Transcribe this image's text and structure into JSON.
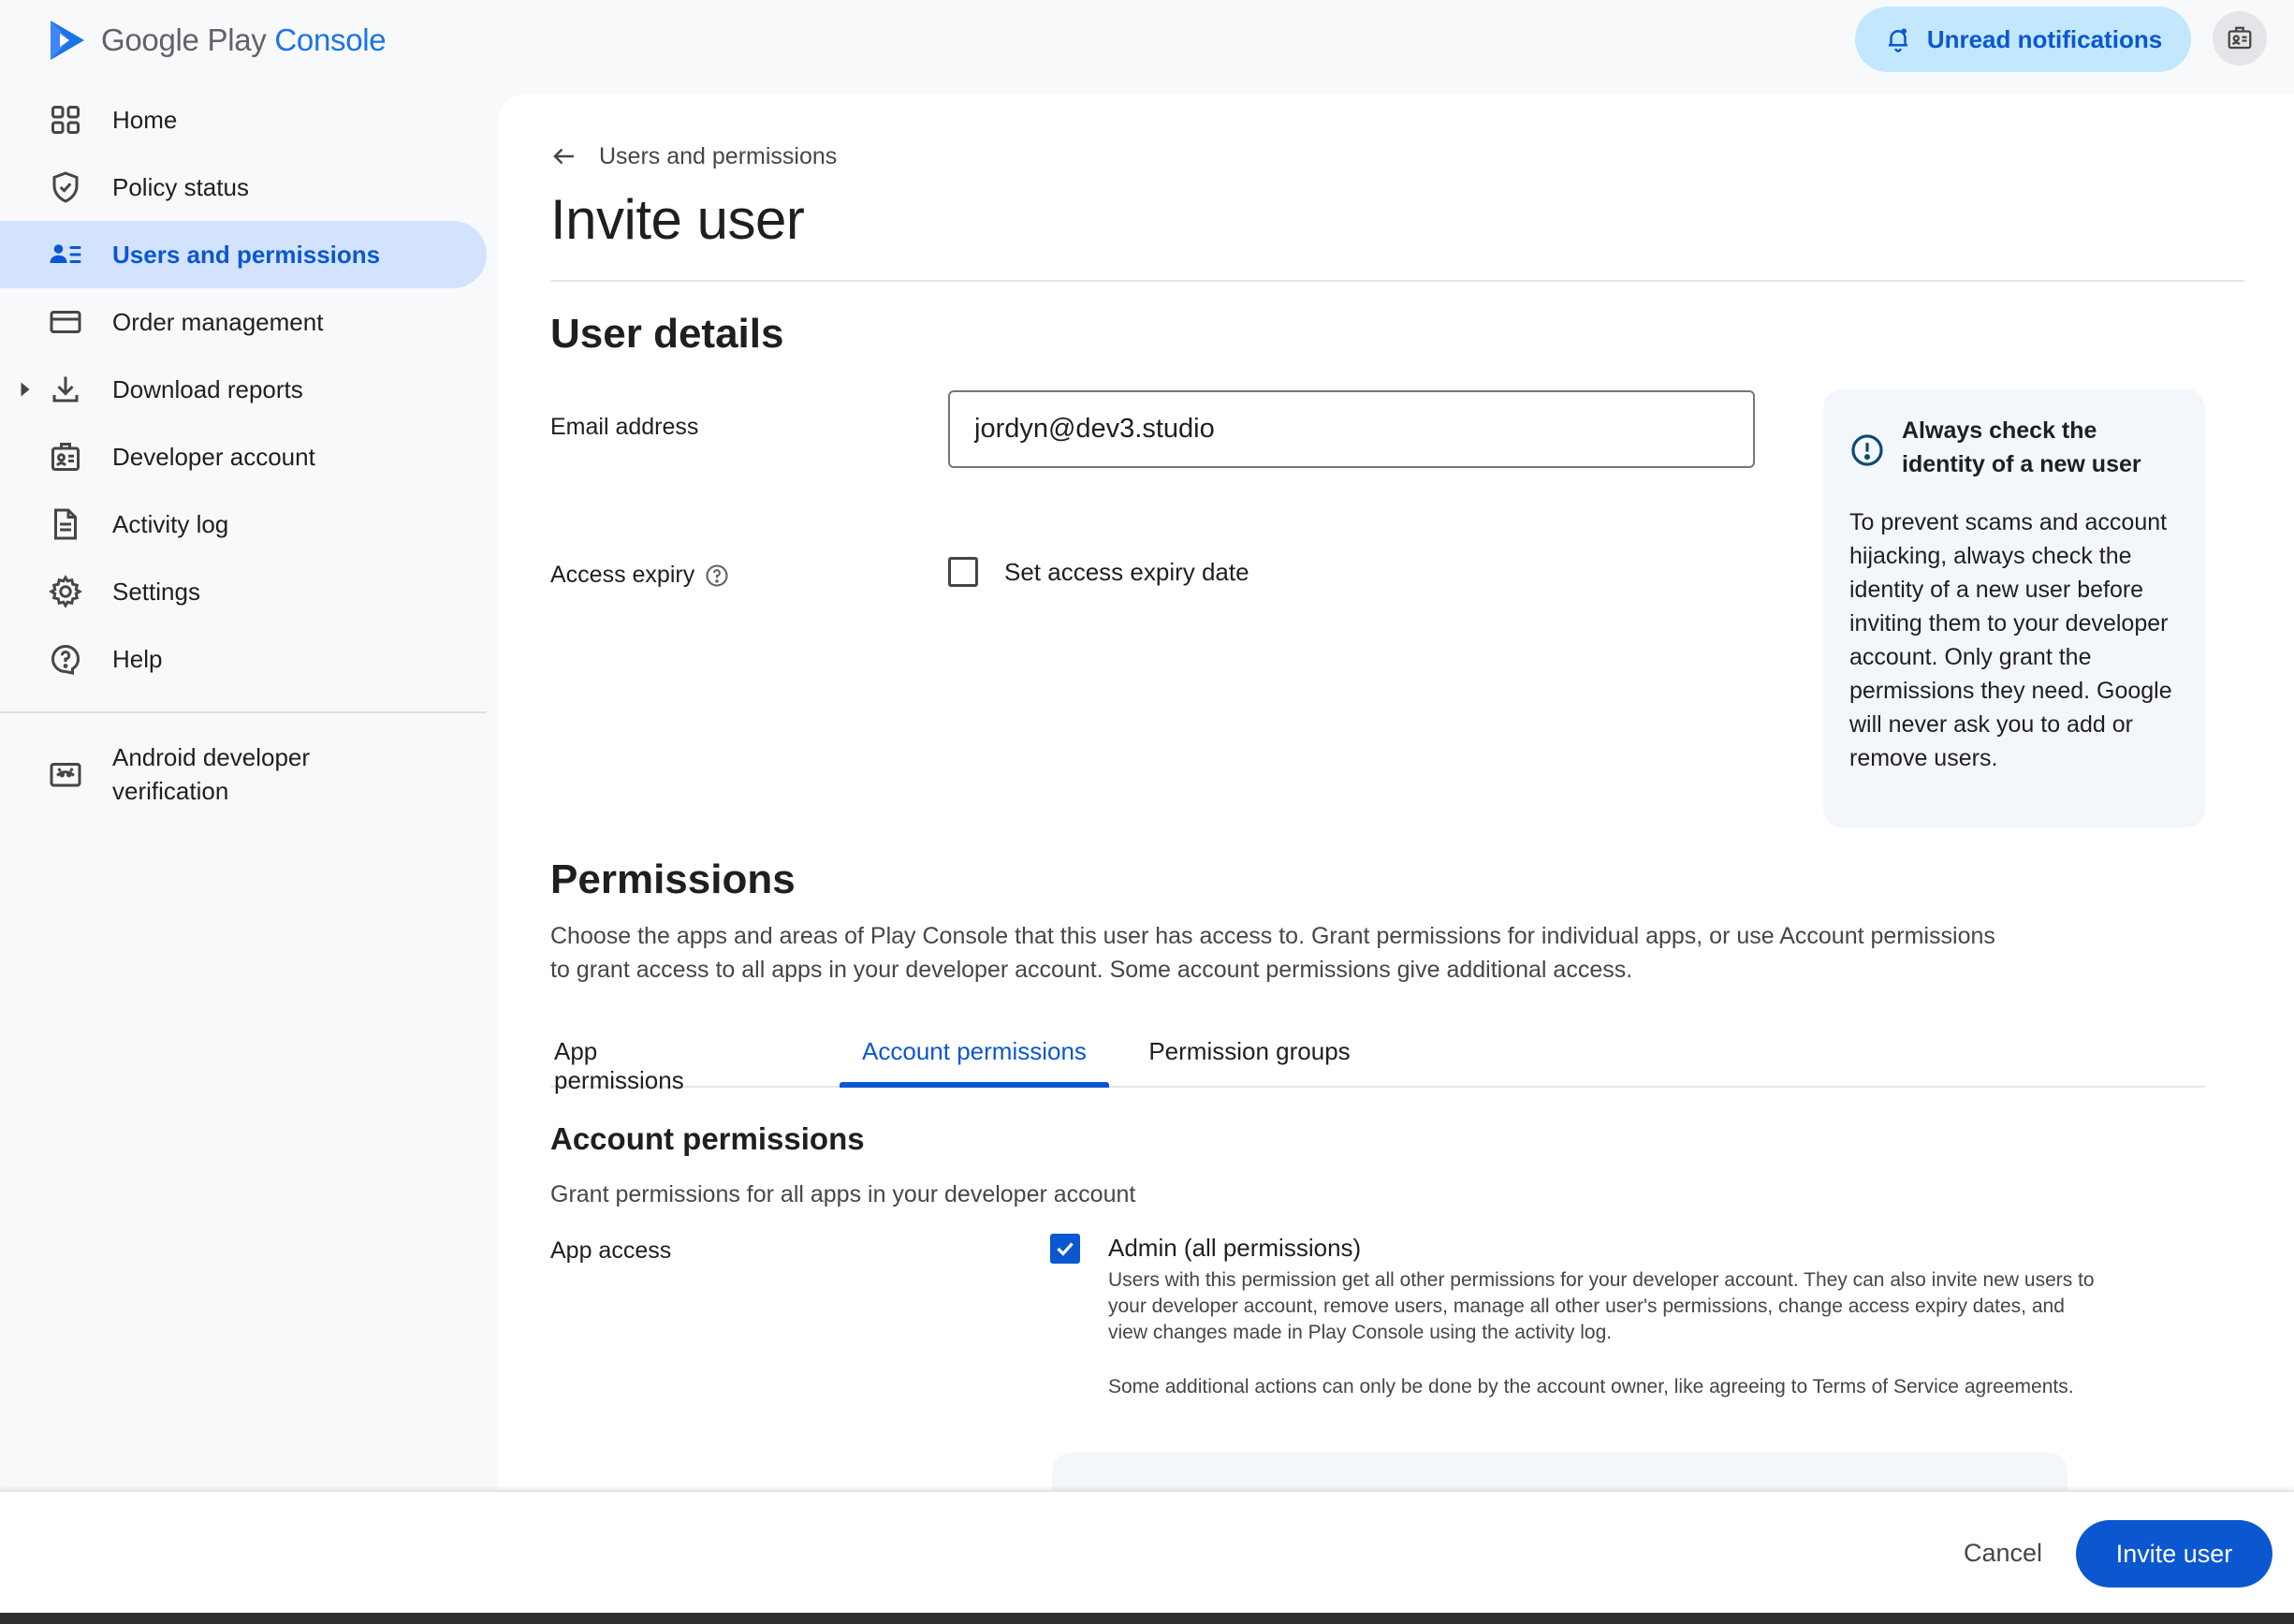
{
  "header": {
    "logo_google_play": "Google Play",
    "logo_console": "Console",
    "notifications_label": "Unread notifications"
  },
  "sidebar": {
    "items": [
      {
        "label": "Home",
        "icon": "grid-icon"
      },
      {
        "label": "Policy status",
        "icon": "shield-icon"
      },
      {
        "label": "Users and permissions",
        "icon": "users-icon",
        "active": true
      },
      {
        "label": "Order management",
        "icon": "credit-card-icon"
      },
      {
        "label": "Download reports",
        "icon": "download-icon"
      },
      {
        "label": "Developer account",
        "icon": "id-badge-icon"
      },
      {
        "label": "Activity log",
        "icon": "document-icon"
      },
      {
        "label": "Settings",
        "icon": "gear-icon"
      },
      {
        "label": "Help",
        "icon": "help-icon"
      }
    ],
    "verification_line1": "Android developer",
    "verification_line2": "verification"
  },
  "main": {
    "breadcrumb": "Users and permissions",
    "title": "Invite user",
    "user_details": {
      "title": "User details",
      "email_label": "Email address",
      "email_value": "jordyn@dev3.studio",
      "expiry_label": "Access expiry",
      "expiry_checkbox_label": "Set access expiry date"
    },
    "info_box": {
      "title": "Always check the identity of a new user",
      "body": "To prevent scams and account hijacking, always check the identity of a new user before inviting them to your developer account. Only grant the permissions they need. Google will never ask you to add or remove users."
    },
    "permissions": {
      "title": "Permissions",
      "description": "Choose the apps and areas of Play Console that this user has access to. Grant permissions for individual apps, or use Account permissions to grant access to all apps in your developer account. Some account permissions give additional access.",
      "tabs": [
        "App permissions",
        "Account permissions",
        "Permission groups"
      ],
      "active_tab": "Account permissions",
      "account_title": "Account permissions",
      "account_desc": "Grant permissions for all apps in your developer account",
      "app_access_label": "App access",
      "admin_label": "Admin (all permissions)",
      "admin_desc1": "Users with this permission get all other permissions for your developer account. They can also invite new users to your developer account, remove users, manage all other user's permissions, change access expiry dates, and view changes made in Play Console using the activity log.",
      "admin_desc2": "Some additional actions can only be done by the account owner, like agreeing to Terms of Service agreements."
    }
  },
  "actions": {
    "cancel": "Cancel",
    "invite": "Invite user"
  },
  "colors": {
    "accent": "#0b57d0",
    "active_nav_bg": "#d3e3fd",
    "notif_bg": "#c2e7ff"
  }
}
